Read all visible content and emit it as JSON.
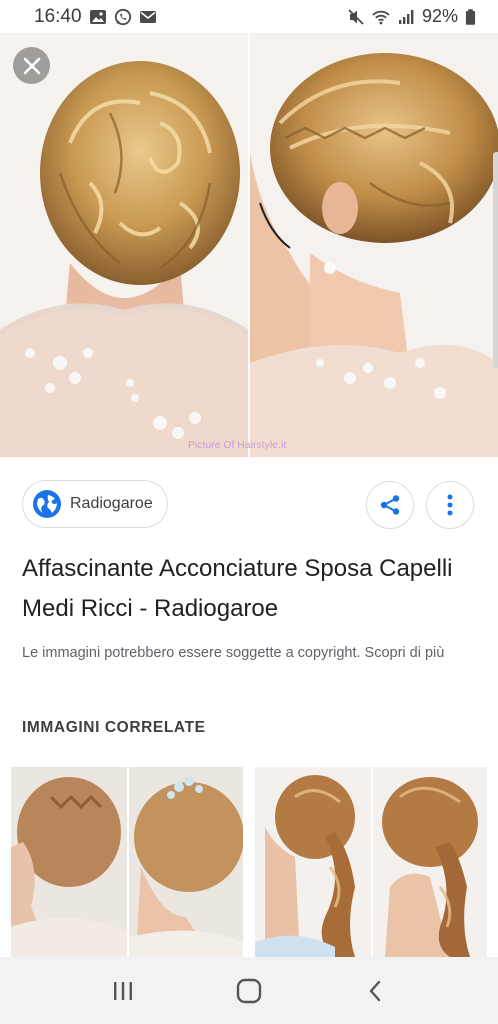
{
  "status_bar": {
    "time": "16:40",
    "battery_percent": "92%",
    "left_icons": [
      "gallery-icon",
      "whatsapp-icon",
      "mail-icon"
    ],
    "right_icons": [
      "mute-icon",
      "wifi-icon",
      "signal-icon",
      "battery-icon"
    ]
  },
  "viewer": {
    "close_icon": "close-icon",
    "watermark": "Picture Of Hairstyle.it"
  },
  "source": {
    "site_name": "Radiogaroe",
    "share_icon": "share-icon",
    "more_icon": "more-vert-icon"
  },
  "result": {
    "title": "Affascinante Acconciature Sposa Capelli Medi Ricci - Radiogaroe",
    "copyright_notice": "Le immagini potrebbero essere soggette a copyright. Scopri di più"
  },
  "related": {
    "heading": "IMMAGINI CORRELATE"
  },
  "nav_bar": {
    "buttons": [
      "recents-icon",
      "home-icon",
      "back-icon"
    ]
  },
  "colors": {
    "accent": "#1a73e8",
    "text_primary": "#202124",
    "text_secondary": "#5f6368",
    "nav_background": "#f2f2f2"
  }
}
